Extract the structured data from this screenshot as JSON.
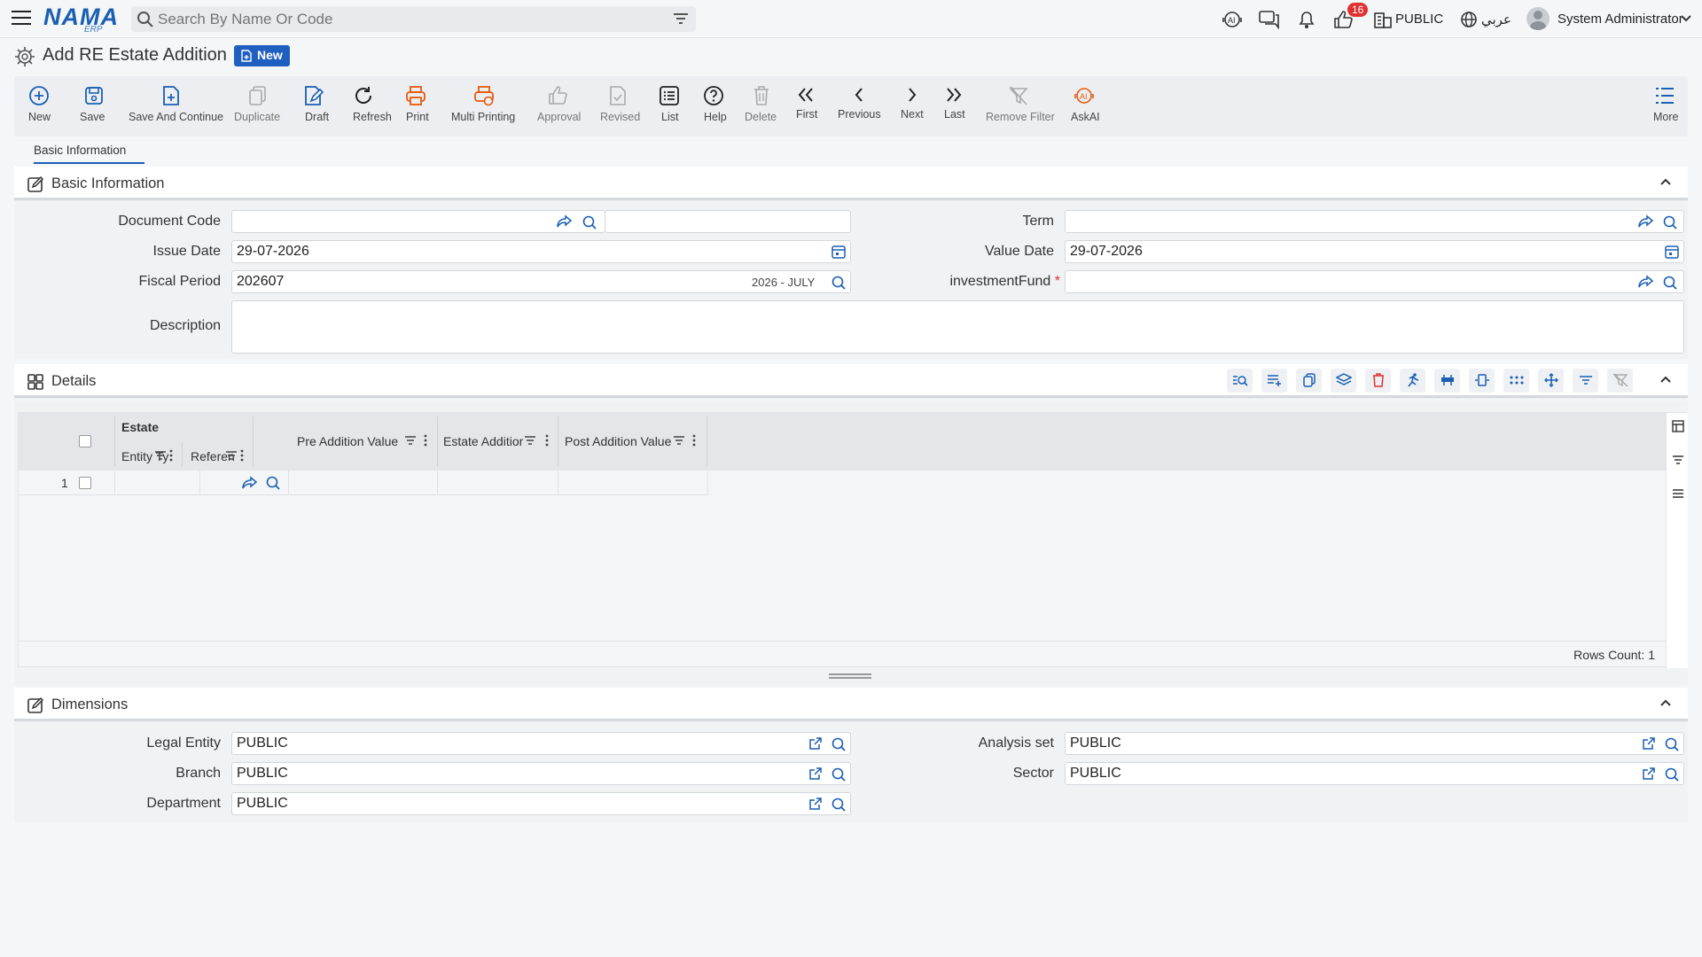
{
  "app": {
    "logo": "NAMA",
    "logo_sub": "ERP",
    "search_placeholder": "Search By Name Or Code",
    "notif_count": "16",
    "company": "PUBLIC",
    "language": "عربي",
    "user": "System Administrator"
  },
  "page": {
    "title": "Add RE Estate Addition",
    "status_badge": "New"
  },
  "toolbar": [
    {
      "label": "New",
      "icon": "plus-circle-icon",
      "color": "#1a5fb4"
    },
    {
      "label": "Save",
      "icon": "save-icon",
      "color": "#1a5fb4"
    },
    {
      "label": "Save And Continue",
      "icon": "file-plus-icon",
      "color": "#1a5fb4"
    },
    {
      "label": "Duplicate",
      "icon": "copy-icon",
      "color": "#aaaaaa"
    },
    {
      "label": "Draft",
      "icon": "edit-file-icon",
      "color": "#1a5fb4"
    },
    {
      "label": "Refresh",
      "icon": "refresh-icon",
      "color": "#222222"
    },
    {
      "label": "Print",
      "icon": "printer-icon",
      "color": "#e8590c"
    },
    {
      "label": "Multi Printing",
      "icon": "multi-printer-icon",
      "color": "#e8590c"
    },
    {
      "label": "Approval",
      "icon": "thumbs-up-icon",
      "color": "#aaaaaa"
    },
    {
      "label": "Revised",
      "icon": "file-check-icon",
      "color": "#aaaaaa"
    },
    {
      "label": "List",
      "icon": "list-icon",
      "color": "#222222"
    },
    {
      "label": "Help",
      "icon": "help-icon",
      "color": "#222222"
    },
    {
      "label": "Delete",
      "icon": "trash-icon",
      "color": "#aaaaaa"
    },
    {
      "label": "First",
      "icon": "double-chevron-left-icon",
      "color": "#222222"
    },
    {
      "label": "Previous",
      "icon": "chevron-left-icon",
      "color": "#222222"
    },
    {
      "label": "Next",
      "icon": "chevron-right-icon",
      "color": "#222222"
    },
    {
      "label": "Last",
      "icon": "double-chevron-right-icon",
      "color": "#222222"
    },
    {
      "label": "Remove Filter",
      "icon": "filter-off-icon",
      "color": "#aaaaaa"
    },
    {
      "label": "AskAI",
      "icon": "ai-icon",
      "color": "#e8590c"
    },
    {
      "label": "More",
      "icon": "more-list-icon",
      "color": "#1a5fb4"
    }
  ],
  "tabs": [
    "Basic Information"
  ],
  "basic": {
    "section_title": "Basic Information",
    "document_code_label": "Document Code",
    "document_code_value": "",
    "term_label": "Term",
    "term_value": "",
    "issue_date_label": "Issue Date",
    "issue_date_value": "29-07-2026",
    "value_date_label": "Value Date",
    "value_date_value": "29-07-2026",
    "fiscal_period_label": "Fiscal Period",
    "fiscal_period_value": "202607",
    "fiscal_period_name": "2026 - JULY",
    "investment_fund_label": "investmentFund",
    "required_mark": "*",
    "investment_fund_value": "",
    "description_label": "Description",
    "description_value": ""
  },
  "details": {
    "section_title": "Details",
    "group_header": "Estate",
    "columns": {
      "entity_type": "Entity Ty",
      "reference": "Referen",
      "pre_addition": "Pre Addition Value",
      "estate_addition": "Estate Additior",
      "post_addition": "Post Addition Value"
    },
    "rows": [
      {
        "index": "1"
      }
    ],
    "rows_count": "Rows Count: 1"
  },
  "dimensions": {
    "section_title": "Dimensions",
    "legal_entity_label": "Legal Entity",
    "legal_entity_value": "PUBLIC",
    "analysis_set_label": "Analysis set",
    "analysis_set_value": "PUBLIC",
    "branch_label": "Branch",
    "branch_value": "PUBLIC",
    "sector_label": "Sector",
    "sector_value": "PUBLIC",
    "department_label": "Department",
    "department_value": "PUBLIC"
  }
}
